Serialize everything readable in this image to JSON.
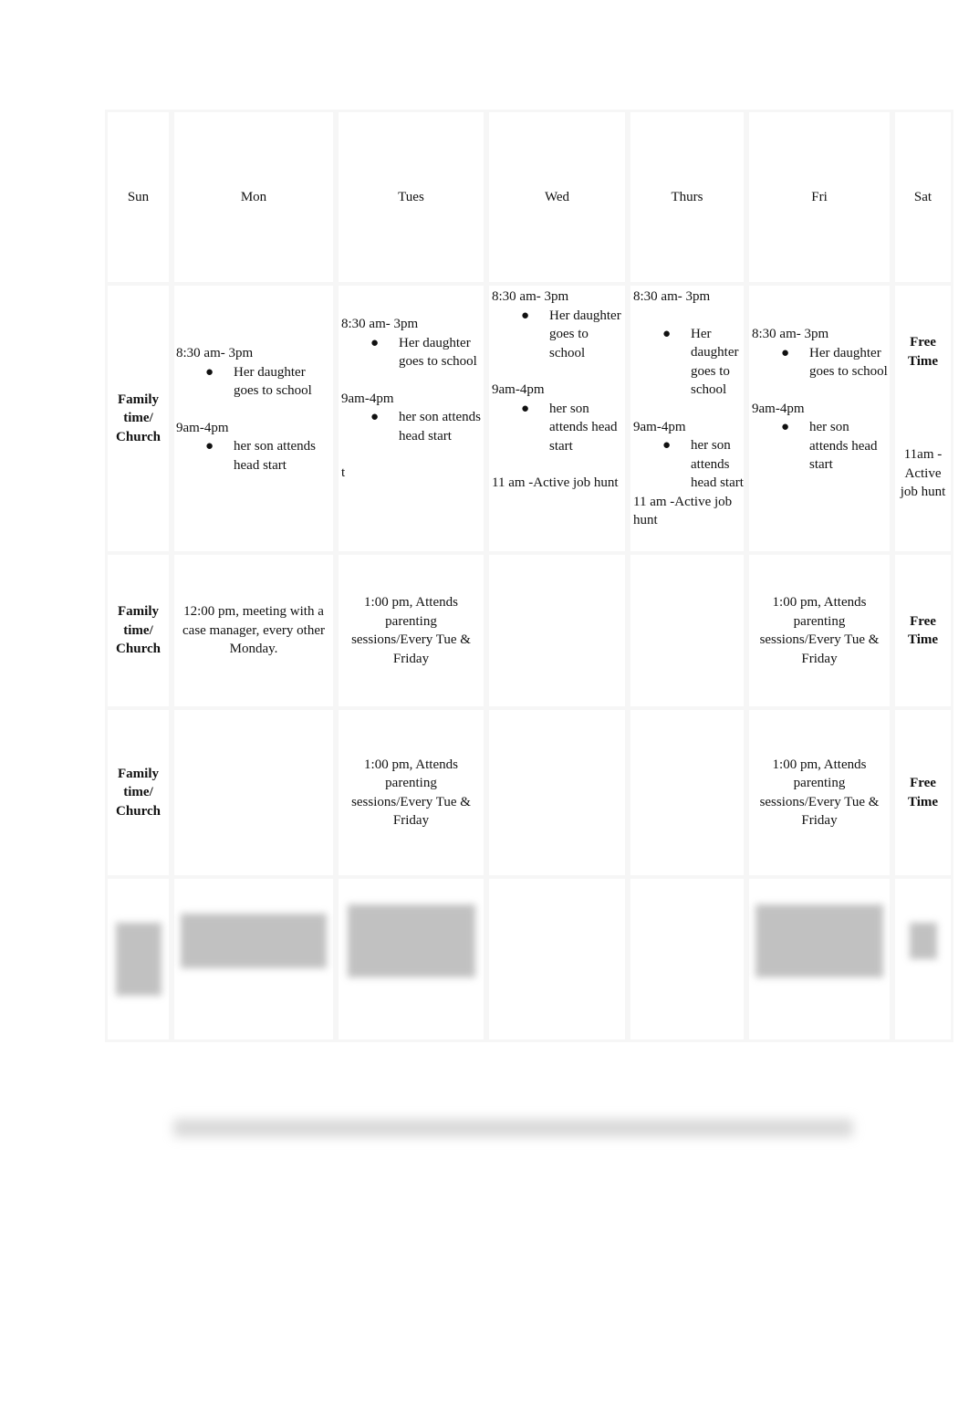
{
  "days": [
    "Sun",
    "Mon",
    "Tues",
    "Wed",
    "Thurs",
    "Fri",
    "Sat"
  ],
  "sunday_label": "Family time/ Church",
  "free_time": "Free Time",
  "row1": {
    "mon": {
      "t1": "8:30 am- 3pm",
      "b1": "Her daughter goes to school",
      "t2": "9am-4pm",
      "b2": "her son attends head start"
    },
    "tues": {
      "t1": "8:30 am- 3pm",
      "b1": "Her daughter goes to school",
      "t2": "9am-4pm",
      "b2": "her son attends head start",
      "t3": "t"
    },
    "wed": {
      "t1": "8:30 am- 3pm",
      "b1": "Her daughter goes to school",
      "t2": "9am-4pm",
      "b2": "her son attends head start",
      "t3": "11 am -Active job hunt"
    },
    "thurs": {
      "t1": "8:30 am- 3pm",
      "b1": "Her daughter goes to school",
      "t2": "9am-4pm",
      "b2": "her son attends head start",
      "t3": "11 am -Active job hunt"
    },
    "fri": {
      "t1": "8:30 am- 3pm",
      "b1": "Her daughter goes to school",
      "t2": "9am-4pm",
      "b2": "her son attends head start"
    },
    "sat": {
      "t1": "Free Time",
      "t2": "11am -Active job hunt"
    }
  },
  "row2": {
    "mon": "12:00 pm, meeting with a case manager, every other Monday.",
    "tues": "1:00 pm, Attends parenting sessions/Every Tue & Friday",
    "fri": "1:00 pm, Attends parenting sessions/Every Tue & Friday"
  },
  "row3": {
    "tues": "1:00 pm, Attends parenting sessions/Every Tue & Friday",
    "fri": "1:00 pm, Attends parenting sessions/Every Tue & Friday"
  },
  "bullet": "●"
}
